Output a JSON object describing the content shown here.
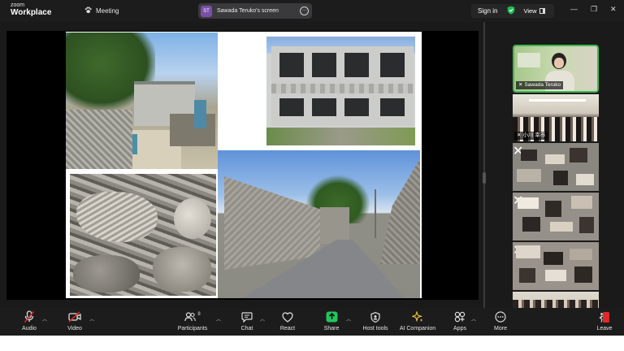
{
  "app": {
    "brand_top": "zoom",
    "brand_bottom": "Workplace",
    "meeting_label": "Meeting"
  },
  "share": {
    "avatar_initials": "ST",
    "avatar_color": "#7a4fa8",
    "title": "Sawada Teruko's screen"
  },
  "header": {
    "signin_label": "Sign in",
    "view_label": "View",
    "shield_color": "#1db954"
  },
  "gallery": {
    "active_border": "#3fb950",
    "tiles": [
      {
        "name": "Sawada Teruko",
        "muted": true
      },
      {
        "name": "小川 幸市",
        "muted": true
      },
      {
        "name": "",
        "muted": true
      },
      {
        "name": "",
        "muted": true
      },
      {
        "name": "",
        "muted": true
      },
      {
        "name": "",
        "muted": true
      }
    ]
  },
  "toolbar": {
    "audio": "Audio",
    "video": "Video",
    "participants": "Participants",
    "participants_count": "8",
    "chat": "Chat",
    "react": "React",
    "share": "Share",
    "share_color": "#22c55e",
    "host_tools": "Host tools",
    "ai_companion": "AI Companion",
    "apps": "Apps",
    "more": "More",
    "leave": "Leave",
    "leave_color": "#e02828"
  }
}
